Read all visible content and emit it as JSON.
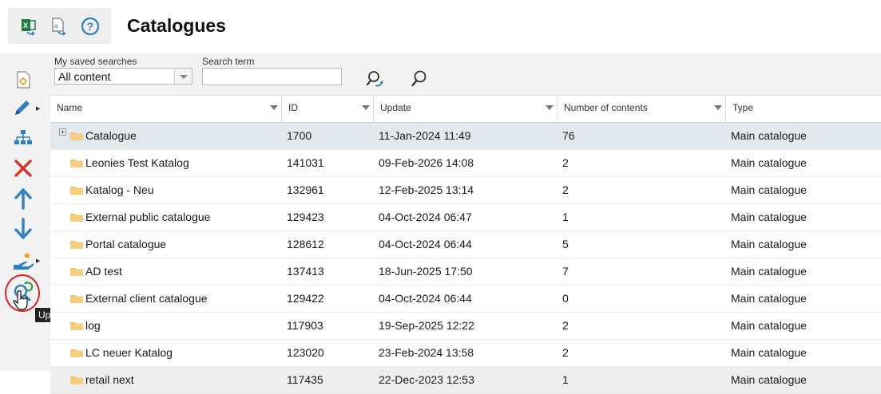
{
  "header": {
    "title": "Catalogues",
    "tools": [
      {
        "name": "excel-export-icon"
      },
      {
        "name": "text-export-icon"
      },
      {
        "name": "help-icon"
      }
    ]
  },
  "sidebar": {
    "buttons": [
      {
        "name": "new-catalogue-icon"
      },
      {
        "name": "edit-pencil-icon",
        "has_menu": true
      },
      {
        "name": "hierarchy-tree-icon"
      },
      {
        "name": "delete-x-icon"
      },
      {
        "name": "move-up-arrow-icon"
      },
      {
        "name": "move-down-arrow-icon"
      },
      {
        "name": "hand-share-icon",
        "has_menu": true
      },
      {
        "name": "update-search-index-icon"
      }
    ],
    "tooltip": "Update search index"
  },
  "search": {
    "saved_label": "My saved searches",
    "saved_value": "All content",
    "term_label": "Search term",
    "term_value": "",
    "term_placeholder": ""
  },
  "table": {
    "columns": [
      "Name",
      "ID",
      "Update",
      "Number of contents",
      "Type"
    ],
    "rows": [
      {
        "name": "Catalogue",
        "id": "1700",
        "update": "11-Jan-2024 11:49",
        "count": "76",
        "type": "Main catalogue",
        "selected": true,
        "expandable": true
      },
      {
        "name": "Leonies Test Katalog",
        "id": "141031",
        "update": "09-Feb-2026 14:08",
        "count": "2",
        "type": "Main catalogue"
      },
      {
        "name": "Katalog - Neu",
        "id": "132961",
        "update": "12-Feb-2025 13:14",
        "count": "2",
        "type": "Main catalogue"
      },
      {
        "name": "External public catalogue",
        "id": "129423",
        "update": "04-Oct-2024 06:47",
        "count": "1",
        "type": "Main catalogue"
      },
      {
        "name": "Portal catalogue",
        "id": "128612",
        "update": "04-Oct-2024 06:44",
        "count": "5",
        "type": "Main catalogue"
      },
      {
        "name": "AD test",
        "id": "137413",
        "update": "18-Jun-2025 17:50",
        "count": "7",
        "type": "Main catalogue"
      },
      {
        "name": "External client catalogue",
        "id": "129422",
        "update": "04-Oct-2024 06:44",
        "count": "0",
        "type": "Main catalogue"
      },
      {
        "name": "log",
        "id": "117903",
        "update": "19-Sep-2025 12:22",
        "count": "2",
        "type": "Main catalogue"
      },
      {
        "name": "LC neuer Katalog",
        "id": "123020",
        "update": "23-Feb-2024 13:58",
        "count": "2",
        "type": "Main catalogue"
      },
      {
        "name": "retail next",
        "id": "117435",
        "update": "22-Dec-2023 12:53",
        "count": "1",
        "type": "Main catalogue"
      }
    ]
  },
  "colors": {
    "accent_blue": "#2f7fc4",
    "delete_red": "#d9362f",
    "excel_green": "#1e7a45",
    "selected_row": "#e4e9ee",
    "folder_yellow": "#f0c46a"
  }
}
